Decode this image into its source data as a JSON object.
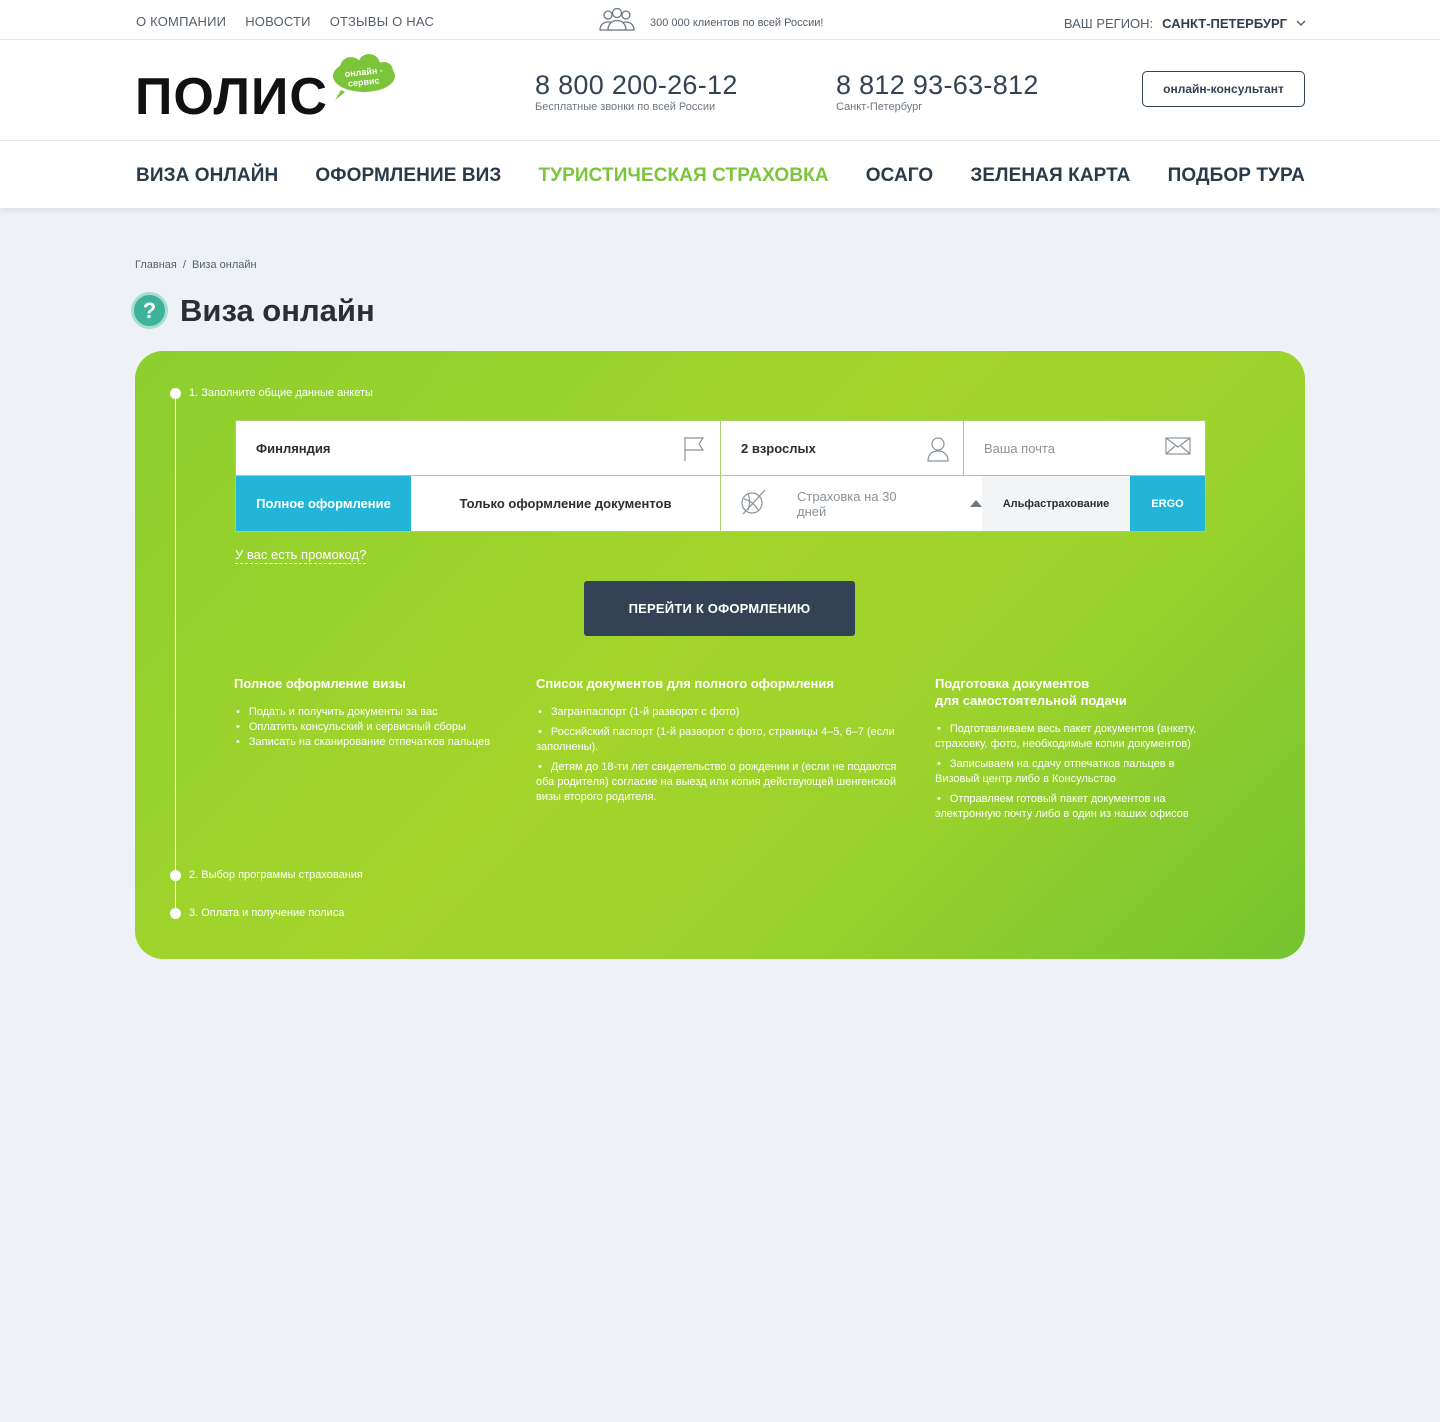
{
  "topbar": {
    "links": [
      "О КОМПАНИИ",
      "НОВОСТИ",
      "ОТЗЫВЫ О НАС"
    ],
    "clients_text": "300 000 клиентов по всей России!",
    "region_label": "ВАШ РЕГИОН:",
    "region_value": "САНКТ-ПЕТЕРБУРГ"
  },
  "header": {
    "logo_word": "ПОЛИС",
    "logo_badge": [
      "онлайн -",
      "сервис"
    ],
    "phone1": {
      "number": "8 800 200-26-12",
      "caption": "Бесплатные звонки по всей России"
    },
    "phone2": {
      "number": "8 812 93-63-812",
      "caption": "Санкт-Петербург"
    },
    "consult_button": "онлайн-консультант"
  },
  "mainnav": {
    "items": [
      "ВИЗА ОНЛАЙН",
      "ОФОРМЛЕНИЕ ВИЗ",
      "ТУРИСТИЧЕСКАЯ СТРАХОВКА",
      "ОСАГО",
      "ЗЕЛЕНАЯ КАРТА",
      "ПОДБОР ТУРА"
    ],
    "active_color": "#7cc43a"
  },
  "breadcrumb": {
    "home": "Главная",
    "sep": "/",
    "current": "Виза онлайн"
  },
  "page": {
    "title": "Виза онлайн",
    "help_icon": "?"
  },
  "form": {
    "steps": [
      "1. Заполните общие данные анкеты",
      "2. Выбор программы страхования",
      "3. Оплата и получение полиса"
    ],
    "country_value": "Финляндия",
    "adults_value": "2 взрослых",
    "email_placeholder": "Ваша почта",
    "option_full": "Полное оформление",
    "option_docs": "Только оформление документов",
    "insurance_label": "Страховка на 30 дней",
    "company_1": "Альфастрахование",
    "company_2": "ERGO",
    "promo_link": "У вас есть промокод?",
    "submit": "ПЕРЕЙТИ К ОФОРМЛЕНИЮ"
  },
  "info": {
    "col1": {
      "title": "Полное оформление визы",
      "items": [
        "Подать и получить документы за вас",
        "Оплатить консульский и сервисный сборы",
        "Записать на сканирование отпечатков пальцев"
      ]
    },
    "col2": {
      "title": "Список документов для полного оформления",
      "items": [
        "Загранпаспорт (1-й разворот с фото)",
        "Российский паспорт (1-й разворот с фото, страницы 4–5, 6–7 (если заполнены).",
        "Детям до 18-ти лет свидетельство о рождении и (если не подаются оба родителя) согласие на выезд или копия действующей шенгенской визы второго родителя."
      ]
    },
    "col3": {
      "title_line1": "Подготовка документов",
      "title_line2": "для самостоятельной подачи",
      "items": [
        "Подготавливаем весь пакет документов (анкету, страховку, фото, необходимые копии документов)",
        "Записываем на сдачу отпечатков пальцев в Визовый центр либо в Консульство",
        "Отправляем готовый пакет документов на электронную почту либо в один из наших офисов"
      ]
    }
  },
  "colors": {
    "accent_blue": "#23b5d8",
    "dark_button": "#334355",
    "panel_green": "#9ad22c"
  },
  "icons": [
    "clients-icon",
    "chevron-down-icon",
    "flag-icon",
    "person-icon",
    "mail-icon",
    "no-insurance-icon",
    "caret-up-icon",
    "help-icon"
  ]
}
